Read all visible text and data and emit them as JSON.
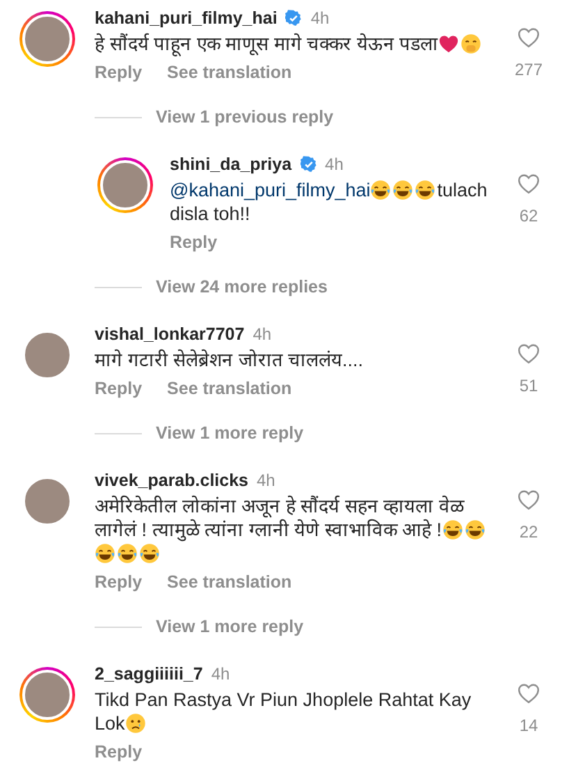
{
  "items": [
    {
      "kind": "comment",
      "username": "kahani_puri_filmy_hai",
      "verified": true,
      "time": "4h",
      "story_ring": true,
      "segments": [
        {
          "kind": "text",
          "text": "हे सौंदर्य पाहून एक माणूस मागे चक्कर येऊन पडला"
        },
        {
          "kind": "heart"
        },
        {
          "kind": "shy"
        }
      ],
      "actions": [
        "Reply",
        "See translation"
      ],
      "likes": "277"
    },
    {
      "kind": "more",
      "label": "View 1 previous reply"
    },
    {
      "kind": "reply",
      "username": "shini_da_priya",
      "verified": true,
      "time": "4h",
      "story_ring": true,
      "segments": [
        {
          "kind": "mention",
          "text": "@kahani_puri_filmy_hai"
        },
        {
          "kind": "laugh"
        },
        {
          "kind": "laugh"
        },
        {
          "kind": "laugh"
        },
        {
          "kind": "text",
          "text": "tulach disla toh!!"
        }
      ],
      "actions": [
        "Reply"
      ],
      "likes": "62"
    },
    {
      "kind": "more",
      "label": "View 24 more replies"
    },
    {
      "kind": "comment",
      "username": "vishal_lonkar7707",
      "verified": false,
      "time": "4h",
      "story_ring": false,
      "segments": [
        {
          "kind": "text",
          "text": "मागे गटारी सेलेब्रेशन जोरात चाललंय...."
        }
      ],
      "actions": [
        "Reply",
        "See translation"
      ],
      "likes": "51"
    },
    {
      "kind": "more",
      "label": "View 1 more reply"
    },
    {
      "kind": "comment",
      "username": "vivek_parab.clicks",
      "verified": false,
      "time": "4h",
      "story_ring": false,
      "segments": [
        {
          "kind": "text",
          "text": "अमेरिकेतील लोकांना अजून हे सौंदर्य सहन व्हायला वेळ लागेलं ! त्यामुळे त्यांना ग्लानी येणे स्वाभाविक आहे !"
        },
        {
          "kind": "laugh"
        },
        {
          "kind": "laugh"
        },
        {
          "kind": "laugh"
        },
        {
          "kind": "laugh"
        },
        {
          "kind": "laugh"
        }
      ],
      "actions": [
        "Reply",
        "See translation"
      ],
      "likes": "22"
    },
    {
      "kind": "more",
      "label": "View 1 more reply"
    },
    {
      "kind": "comment",
      "username": "2_saggiiiiii_7",
      "verified": false,
      "time": "4h",
      "story_ring": true,
      "segments": [
        {
          "kind": "text",
          "text": "Tikd Pan Rastya Vr Piun Jhoplele Rahtat Kay Lok"
        },
        {
          "kind": "sad"
        }
      ],
      "actions": [
        "Reply"
      ],
      "likes": "14"
    }
  ]
}
